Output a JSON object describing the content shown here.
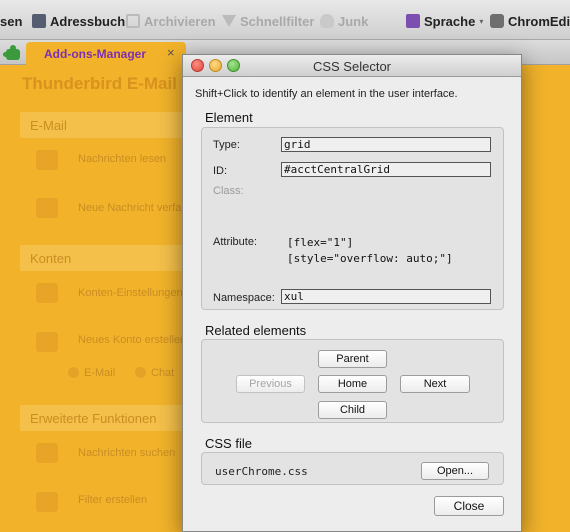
{
  "toolbar": {
    "items": [
      {
        "label": "sen",
        "icon": ""
      },
      {
        "label": "Adressbuch",
        "icon": "address-book-icon"
      },
      {
        "label": "Archivieren",
        "icon": "archive-icon"
      },
      {
        "label": "Schnellfilter",
        "icon": "quick-filter-icon"
      },
      {
        "label": "Junk",
        "icon": "junk-icon"
      },
      {
        "label": "Sprache",
        "icon": "language-icon"
      },
      {
        "label": "ChromEdit",
        "icon": "chromedit-icon"
      }
    ],
    "dropdown_glyph": "▾"
  },
  "tab": {
    "label": "Add-ons-Manager",
    "close_glyph": "×",
    "icon": "addon-puzzle-icon"
  },
  "background_page": {
    "title": "Thunderbird E-Mail -",
    "sections": [
      {
        "label": "E-Mail",
        "items": [
          "Nachrichten lesen",
          "Neue Nachricht verfas"
        ]
      },
      {
        "label": "Konten",
        "items": [
          "Konten-Einstellungen",
          "Neues Konto erstellen"
        ],
        "subitems": [
          "E-Mail",
          "Chat"
        ]
      },
      {
        "label": "Erweiterte Funktionen",
        "items": [
          "Nachrichten suchen",
          "Filter erstellen"
        ]
      }
    ]
  },
  "dialog": {
    "title": "CSS Selector",
    "hint": "Shift+Click to identify an element in the user interface.",
    "element_group": "Element",
    "fields": {
      "type_label": "Type:",
      "type_value": "grid",
      "id_label": "ID:",
      "id_value": "#acctCentralGrid",
      "class_label": "Class:",
      "attribute_label": "Attribute:",
      "attributes": [
        "[flex=\"1\"]",
        "[style=\"overflow: auto;\"]"
      ],
      "namespace_label": "Namespace:",
      "namespace_value": "xul"
    },
    "related_group": "Related elements",
    "related_buttons": {
      "parent": "Parent",
      "previous": "Previous",
      "home": "Home",
      "next": "Next",
      "child": "Child"
    },
    "css_group": "CSS file",
    "css_file": "userChrome.css",
    "open_button": "Open...",
    "close_button": "Close"
  },
  "colors": {
    "page_background": "#f2b32b",
    "tab_label": "#7c2fb3",
    "dialog_background": "#ededed"
  }
}
